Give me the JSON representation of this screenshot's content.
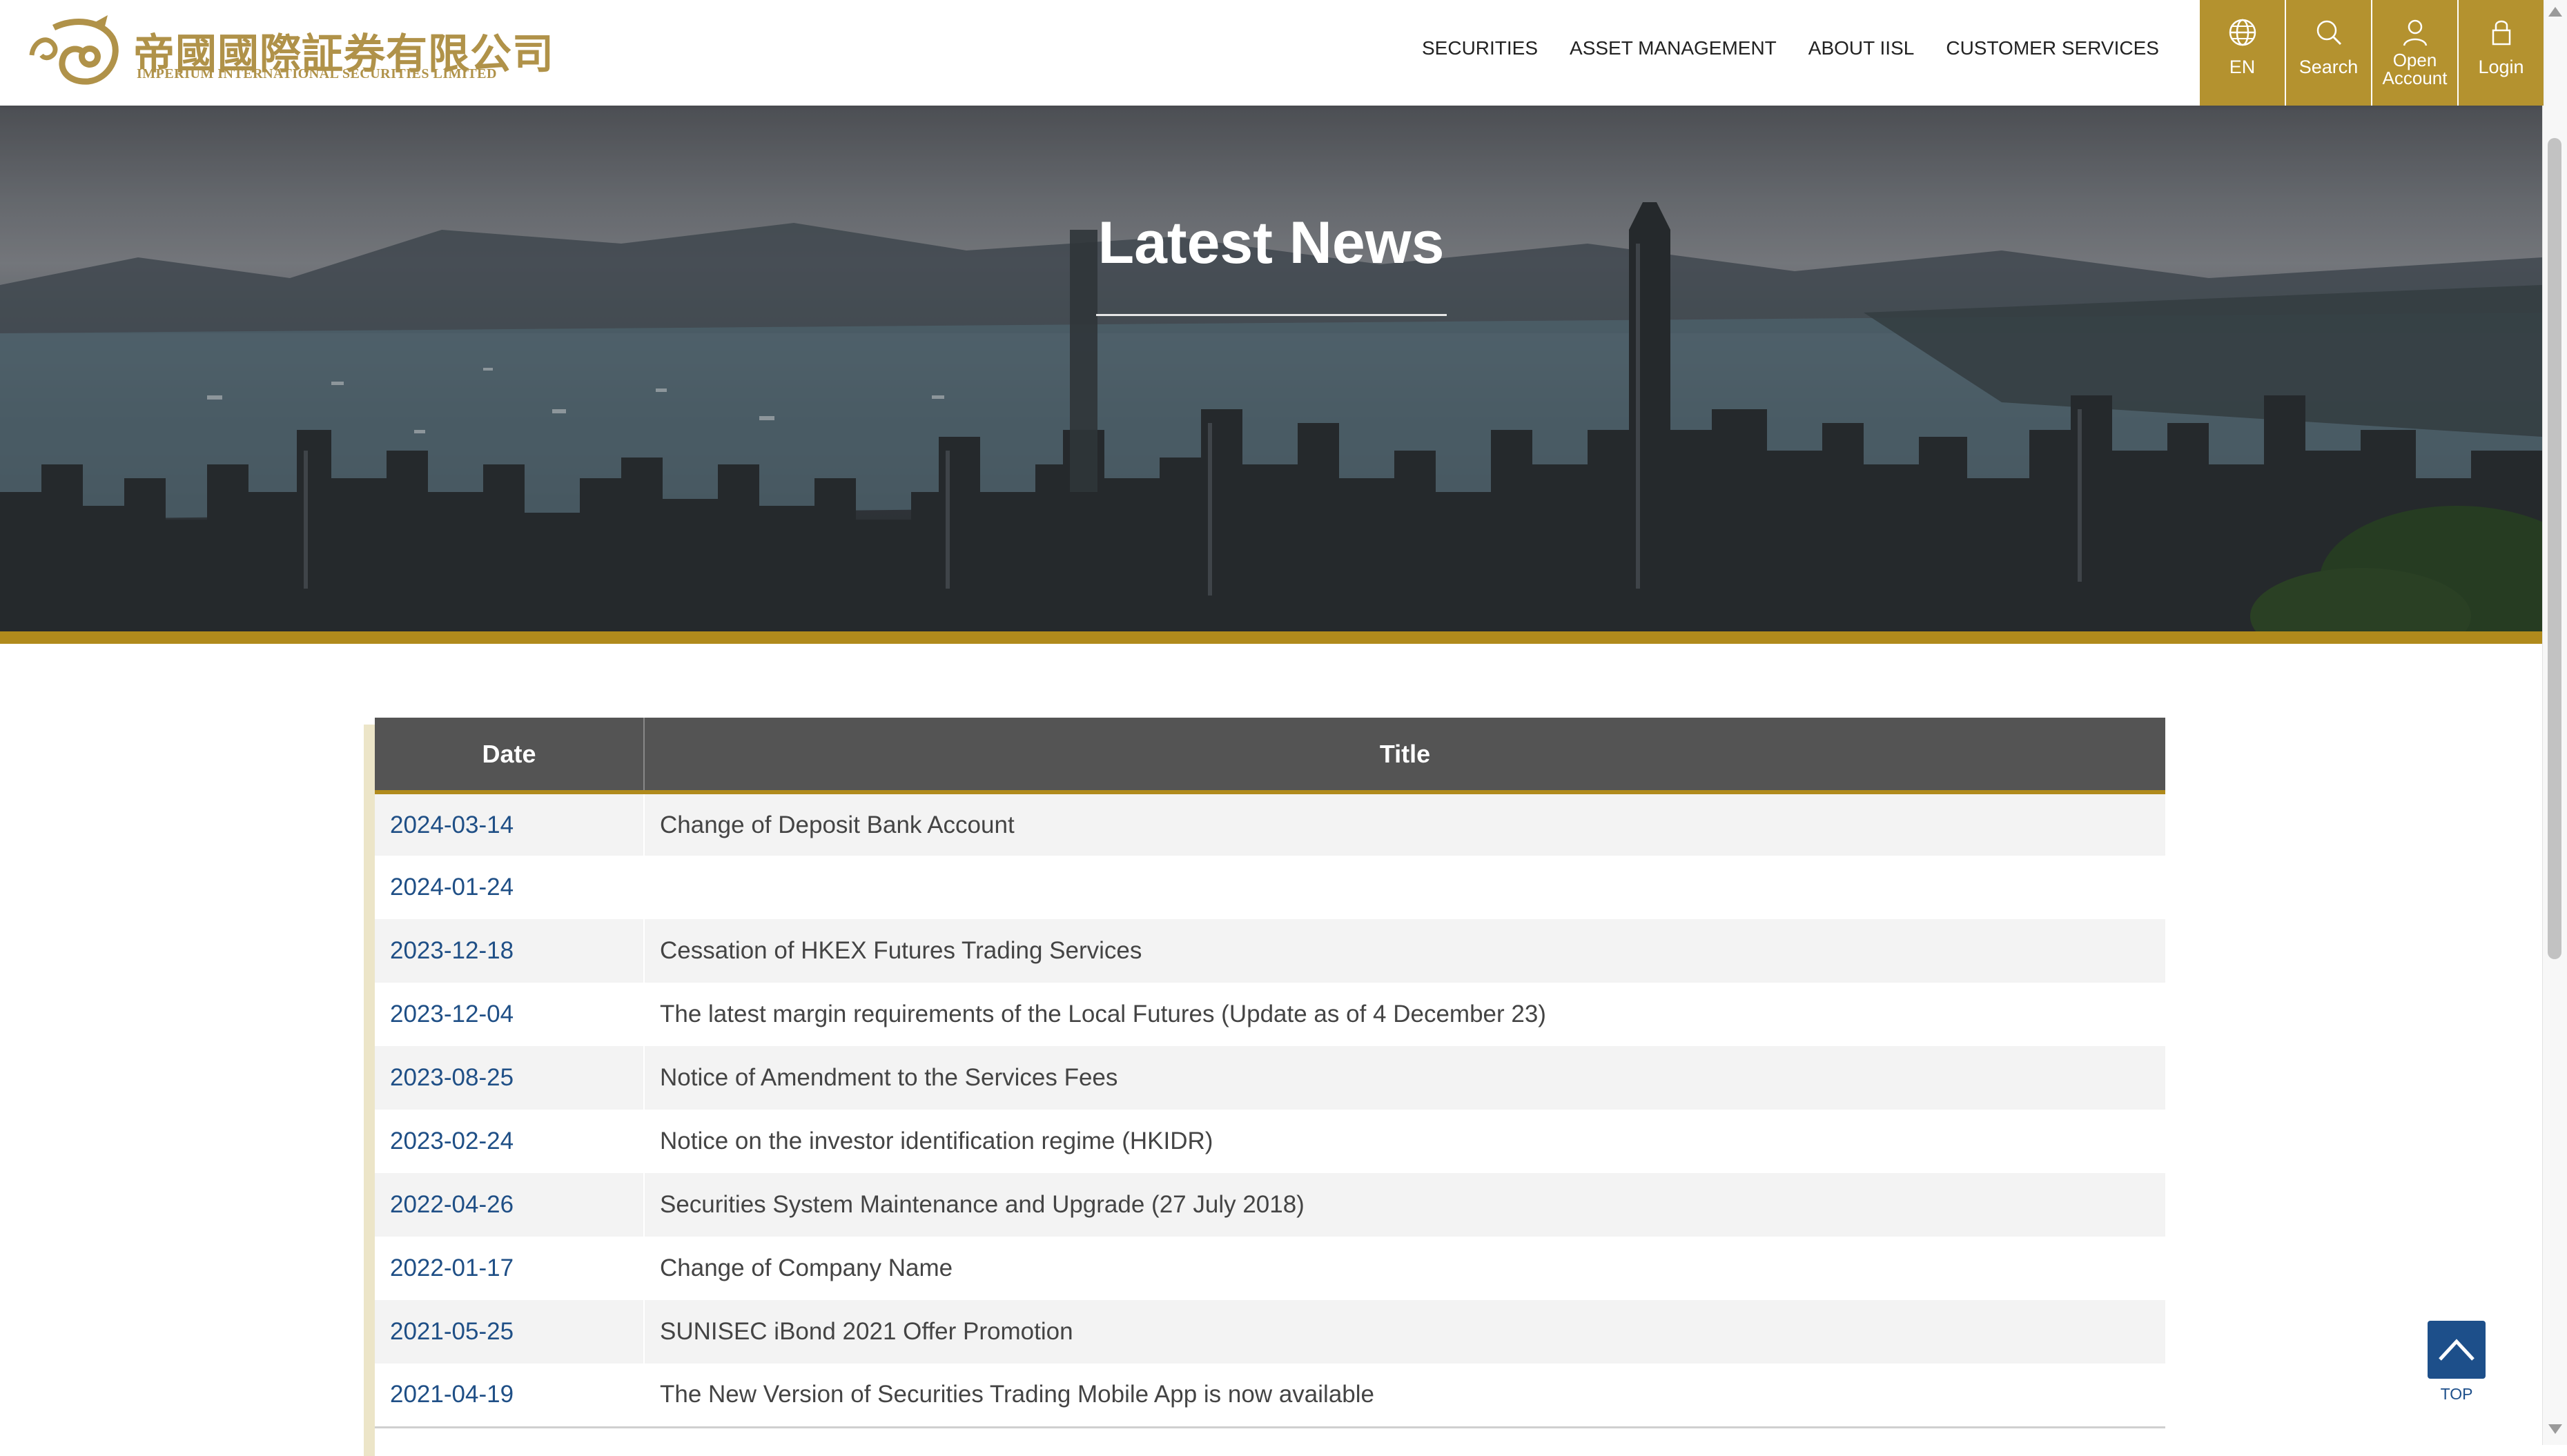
{
  "header": {
    "logo_cn": "帝國國際証券有限公司",
    "logo_en": "IMPERIUM INTERNATIONAL SECURITIES LIMITED",
    "nav": [
      {
        "label": "SECURITIES"
      },
      {
        "label": "ASSET MANAGEMENT"
      },
      {
        "label": "ABOUT IISL"
      },
      {
        "label": "CUSTOMER SERVICES"
      }
    ],
    "tools": {
      "language": {
        "label": "EN",
        "icon": "globe-icon"
      },
      "search": {
        "label": "Search",
        "icon": "search-icon"
      },
      "open_account_line1": "Open",
      "open_account_line2": "Account",
      "open_account_icon": "user-icon",
      "login": {
        "label": "Login",
        "icon": "lock-icon"
      }
    }
  },
  "hero": {
    "title": "Latest News"
  },
  "table": {
    "headers": {
      "date": "Date",
      "title": "Title"
    },
    "rows": [
      {
        "date": "2024-03-14",
        "title": "Change of Deposit Bank Account"
      },
      {
        "date": "2024-01-24",
        "title": ""
      },
      {
        "date": "2023-12-18",
        "title": "Cessation of HKEX Futures Trading Services"
      },
      {
        "date": "2023-12-04",
        "title": "The latest margin requirements of the Local Futures (Update as of 4 December 23)"
      },
      {
        "date": "2023-08-25",
        "title": "Notice of Amendment to the Services Fees"
      },
      {
        "date": "2023-02-24",
        "title": "Notice on the investor identification regime (HKIDR)"
      },
      {
        "date": "2022-04-26",
        "title": "Securities System Maintenance and Upgrade (27 July 2018)"
      },
      {
        "date": "2022-01-17",
        "title": "Change of Company Name"
      },
      {
        "date": "2021-05-25",
        "title": "SUNISEC iBond 2021 Offer Promotion"
      },
      {
        "date": "2021-04-19",
        "title": "The New Version of Securities Trading Mobile App is now available"
      }
    ]
  },
  "top_button": {
    "label": "TOP",
    "icon": "chevron-up-icon"
  },
  "colors": {
    "gold": "#b4922f",
    "gold_bar": "#b08a1c",
    "header_gray": "#545454",
    "date_blue": "#1f4f86",
    "top_blue": "#1d4f8a"
  }
}
